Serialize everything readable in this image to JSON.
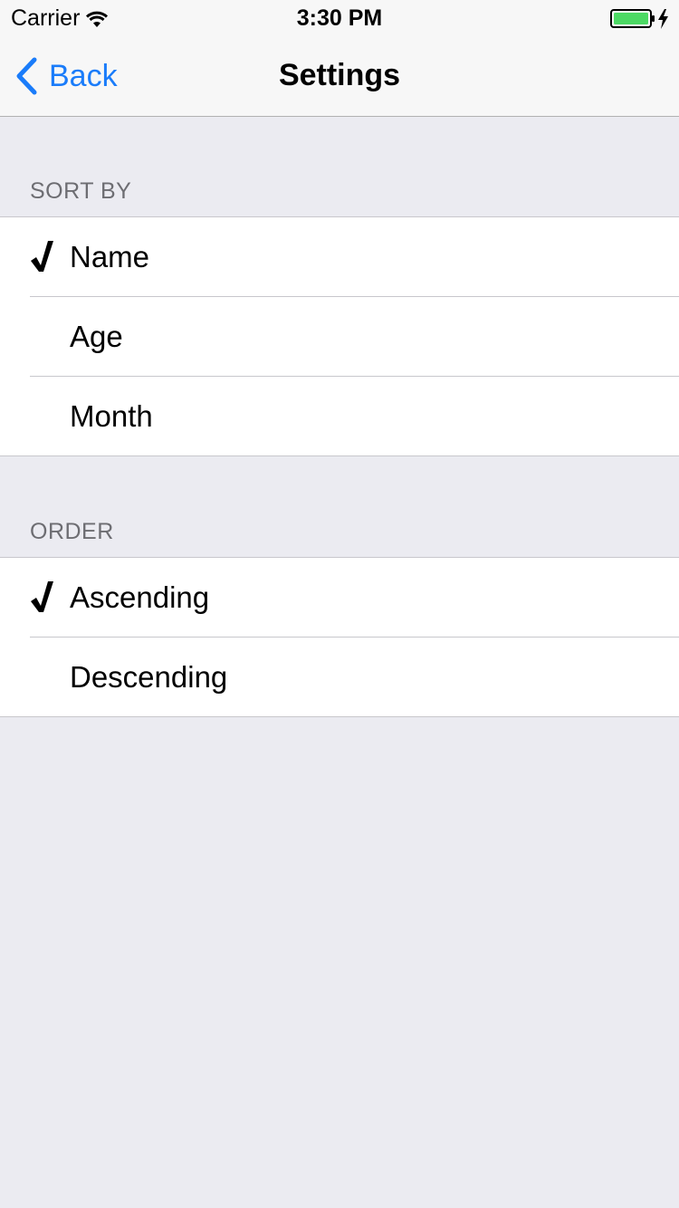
{
  "status_bar": {
    "carrier": "Carrier",
    "time": "3:30 PM",
    "wifi_icon": "wifi-icon",
    "battery_icon": "battery-charging-icon",
    "battery_color": "#4cd964"
  },
  "nav": {
    "back_label": "Back",
    "title": "Settings",
    "accent_color": "#1a7cfa"
  },
  "sort_section": {
    "header": "SORT BY",
    "options": [
      {
        "label": "Name",
        "selected": true
      },
      {
        "label": "Age",
        "selected": false
      },
      {
        "label": "Month",
        "selected": false
      }
    ]
  },
  "order_section": {
    "header": "ORDER",
    "options": [
      {
        "label": "Ascending",
        "selected": true
      },
      {
        "label": "Descending",
        "selected": false
      }
    ]
  }
}
